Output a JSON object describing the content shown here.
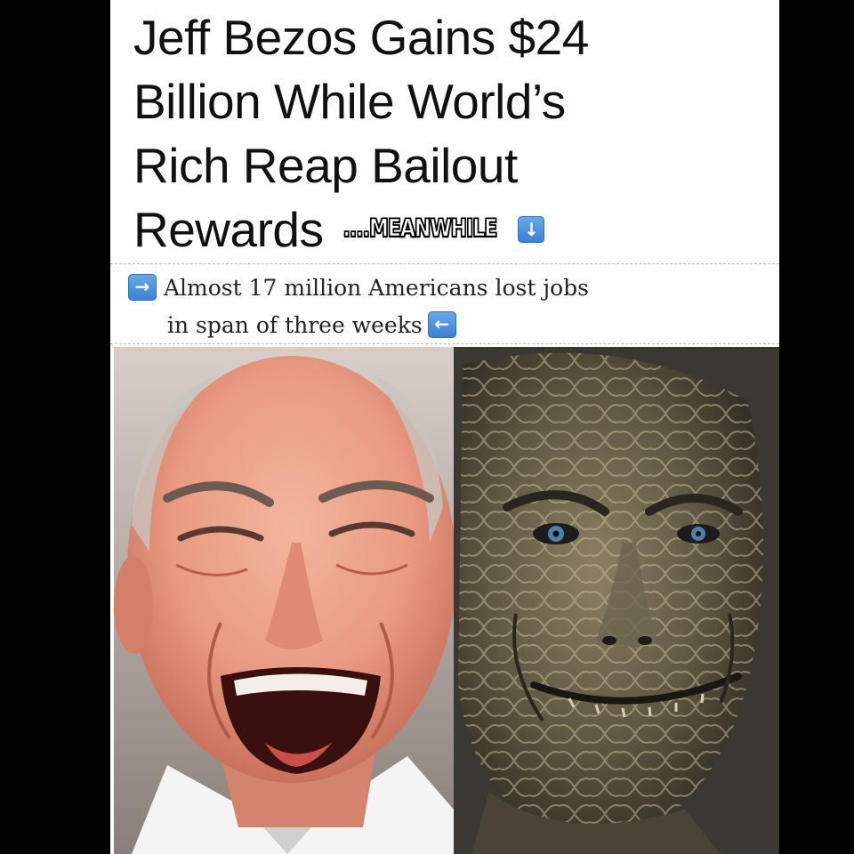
{
  "headline": {
    "line1": "Jeff Bezos Gains $24",
    "line2": "Billion While World’s",
    "line3": "Rich Reap Bailout",
    "line4": "Rewards",
    "meanwhile": "....MEANWHILE",
    "down_arrow_icon": "down-arrow-emoji"
  },
  "subtext": {
    "line1": "Almost 17 million Americans lost jobs",
    "line2": "in span of three weeks",
    "right_arrow_icon": "right-arrow-emoji",
    "left_arrow_icon": "left-arrow-emoji"
  },
  "photos": {
    "left_subject": "laughing-man-photo",
    "right_subject": "reptilian-creature-photo"
  },
  "colors": {
    "background": "#000000",
    "card": "#ffffff",
    "headline_text": "#111111",
    "emoji_blue": "#4a8fdd"
  }
}
